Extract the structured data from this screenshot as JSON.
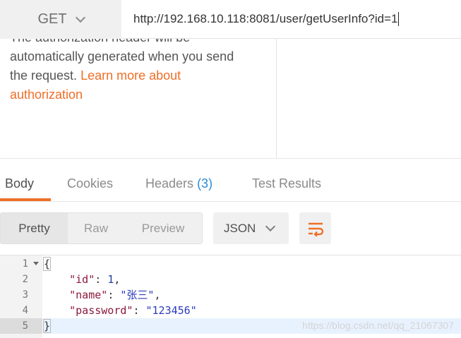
{
  "request": {
    "method": "GET",
    "url": "http://192.168.10.118:8081/user/getUserInfo?id=1"
  },
  "auth": {
    "line1": "The authorization header will be",
    "line2": "automatically generated when you send",
    "line3_prefix": "the request. ",
    "link_part1": "Learn more about",
    "link_part2": "authorization"
  },
  "response_tabs": [
    {
      "label": "Body",
      "active": true
    },
    {
      "label": "Cookies"
    },
    {
      "label": "Headers",
      "count": "(3)"
    },
    {
      "label": "Test Results"
    }
  ],
  "format_buttons": [
    {
      "label": "Pretty",
      "active": true
    },
    {
      "label": "Raw"
    },
    {
      "label": "Preview"
    }
  ],
  "format_select": "JSON",
  "icons": {
    "wrap": "wrap-lines-icon",
    "dropdown": "chevron-down-icon",
    "fold": "fold-arrow-icon"
  },
  "colors": {
    "accent": "#ef6f28",
    "count": "#2d8bd6"
  },
  "code": {
    "line_numbers": [
      "1",
      "2",
      "3",
      "4",
      "5"
    ],
    "open_brace": "{",
    "close_brace": "}",
    "fields": [
      {
        "key": "\"id\"",
        "sep": ": ",
        "value": "1",
        "trail": ","
      },
      {
        "key": "\"name\"",
        "sep": ": ",
        "value": "\"张三\"",
        "trail": ","
      },
      {
        "key": "\"password\"",
        "sep": ": ",
        "value": "\"123456\"",
        "trail": ""
      }
    ]
  },
  "watermark": "https://blog.csdn.net/qq_21067307"
}
